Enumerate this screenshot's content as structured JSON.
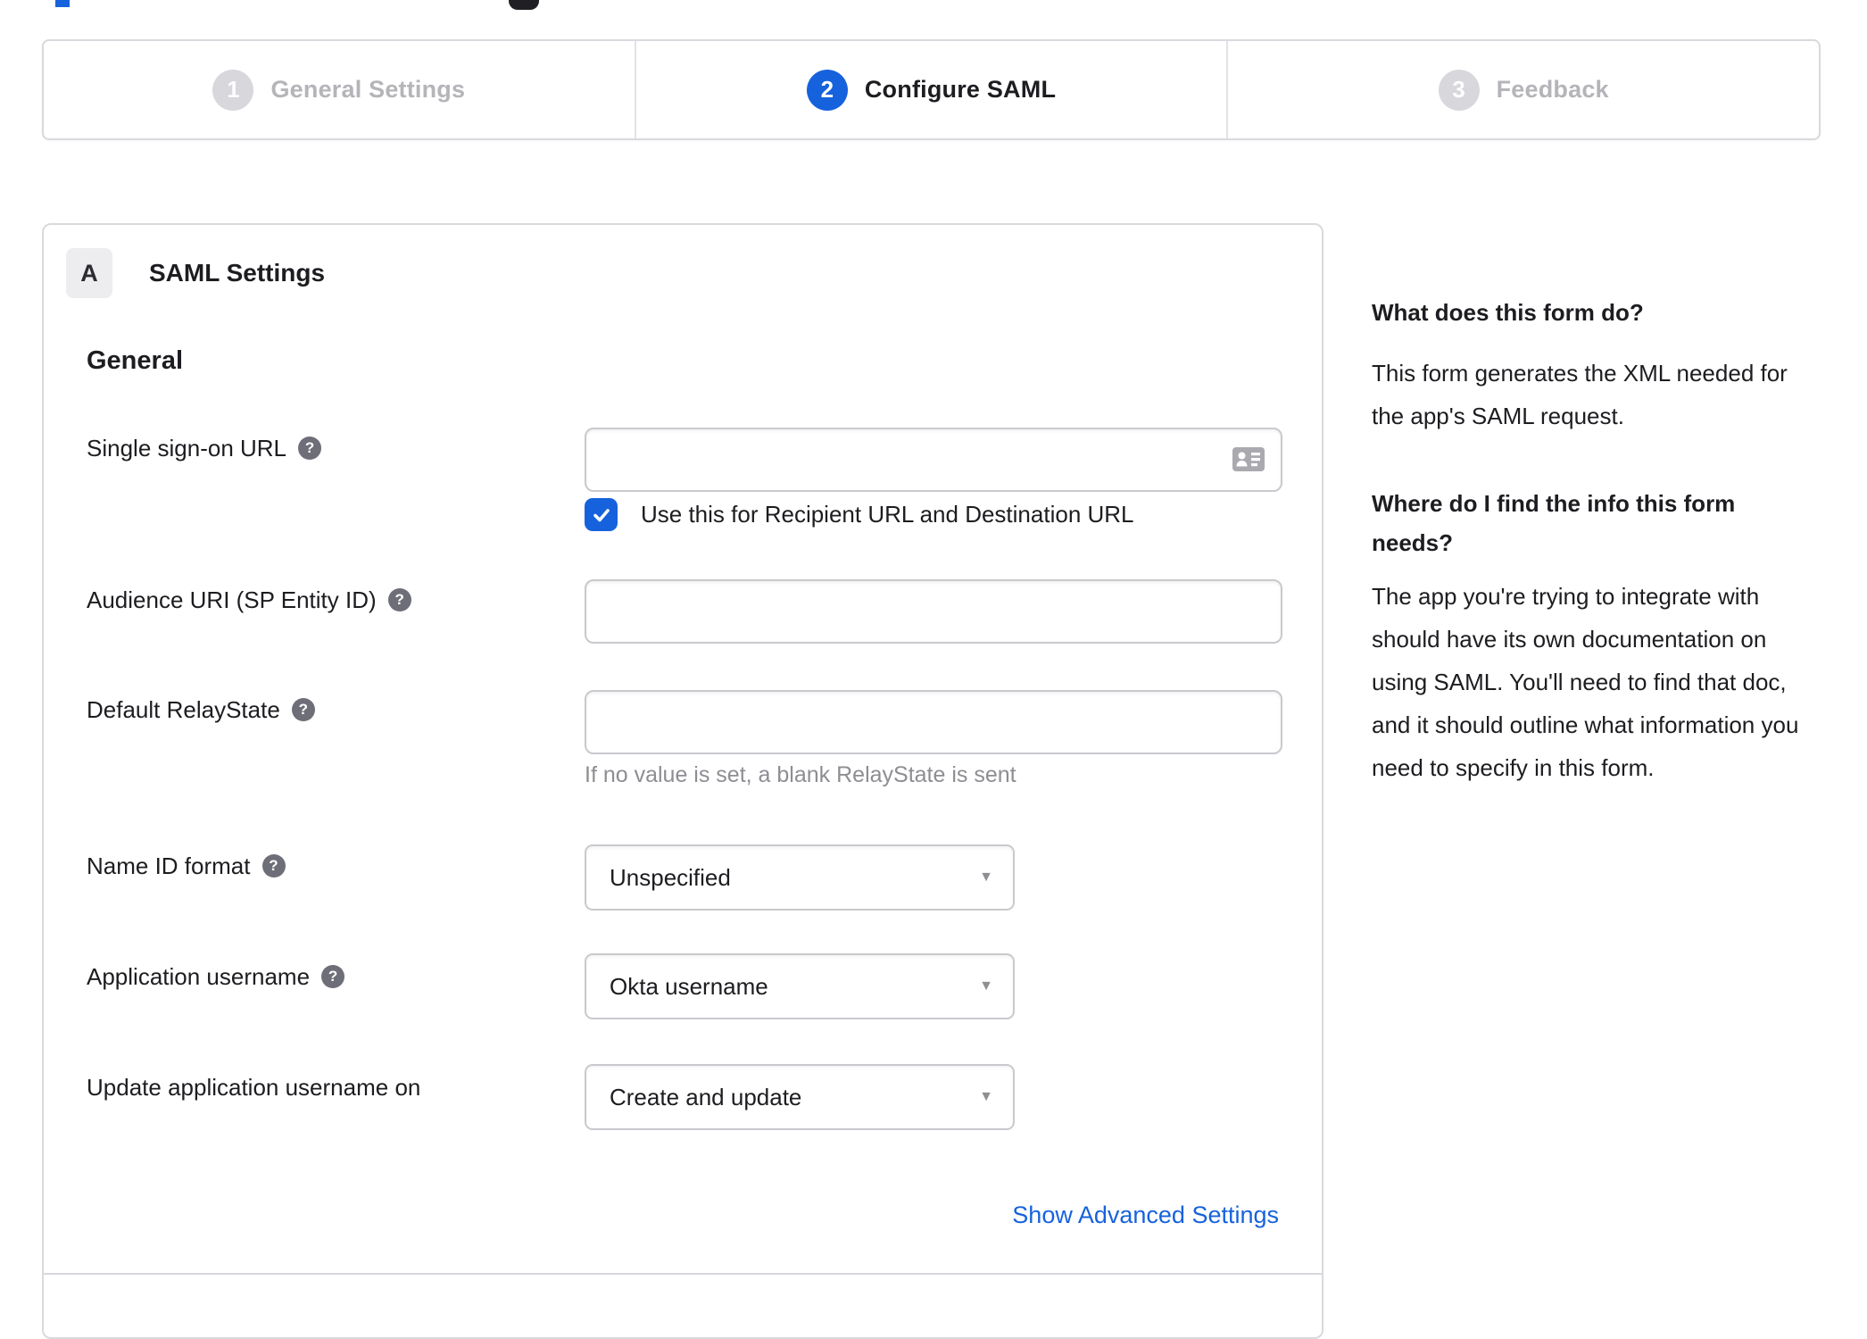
{
  "stepper": {
    "active_step": "2",
    "steps": [
      {
        "number": "1",
        "label": "General Settings"
      },
      {
        "number": "2",
        "label": "Configure SAML"
      },
      {
        "number": "3",
        "label": "Feedback"
      }
    ]
  },
  "saml_panel": {
    "section_badge": "A",
    "title": "SAML Settings",
    "group_heading": "General",
    "fields": {
      "sso_url": {
        "label": "Single sign-on URL",
        "value": "",
        "checkbox_label": "Use this for Recipient URL and Destination URL",
        "checkbox_checked": true
      },
      "audience_uri": {
        "label": "Audience URI (SP Entity ID)",
        "value": ""
      },
      "default_relay_state": {
        "label": "Default RelayState",
        "value": "",
        "hint": "If no value is set, a blank RelayState is sent"
      },
      "name_id_format": {
        "label": "Name ID format",
        "selected": "Unspecified"
      },
      "application_username": {
        "label": "Application username",
        "selected": "Okta username"
      },
      "update_app_username_on": {
        "label": "Update application username on",
        "selected": "Create and update"
      }
    },
    "advanced_link": "Show Advanced Settings"
  },
  "help_sidebar": {
    "question_1": "What does this form do?",
    "answer_1": "This form generates the XML needed for the app's SAML request.",
    "question_2": "Where do I find the info this form needs?",
    "answer_2": "The app you're trying to integrate with should have its own documentation on using SAML. You'll need to find that doc, and it should outline what information you need to specify in this form."
  },
  "icons": {
    "help": "?",
    "dropdown_caret": "▼",
    "sso_field_icon": "contact-card-icon",
    "checkbox_icon": "checkmark-icon"
  },
  "colors": {
    "accent_blue": "#1662dd",
    "inactive_gray": "#d7d7dc",
    "text_dark": "#1d1d21",
    "border_gray": "#c9c9ce",
    "help_icon_gray": "#6e6e78"
  }
}
